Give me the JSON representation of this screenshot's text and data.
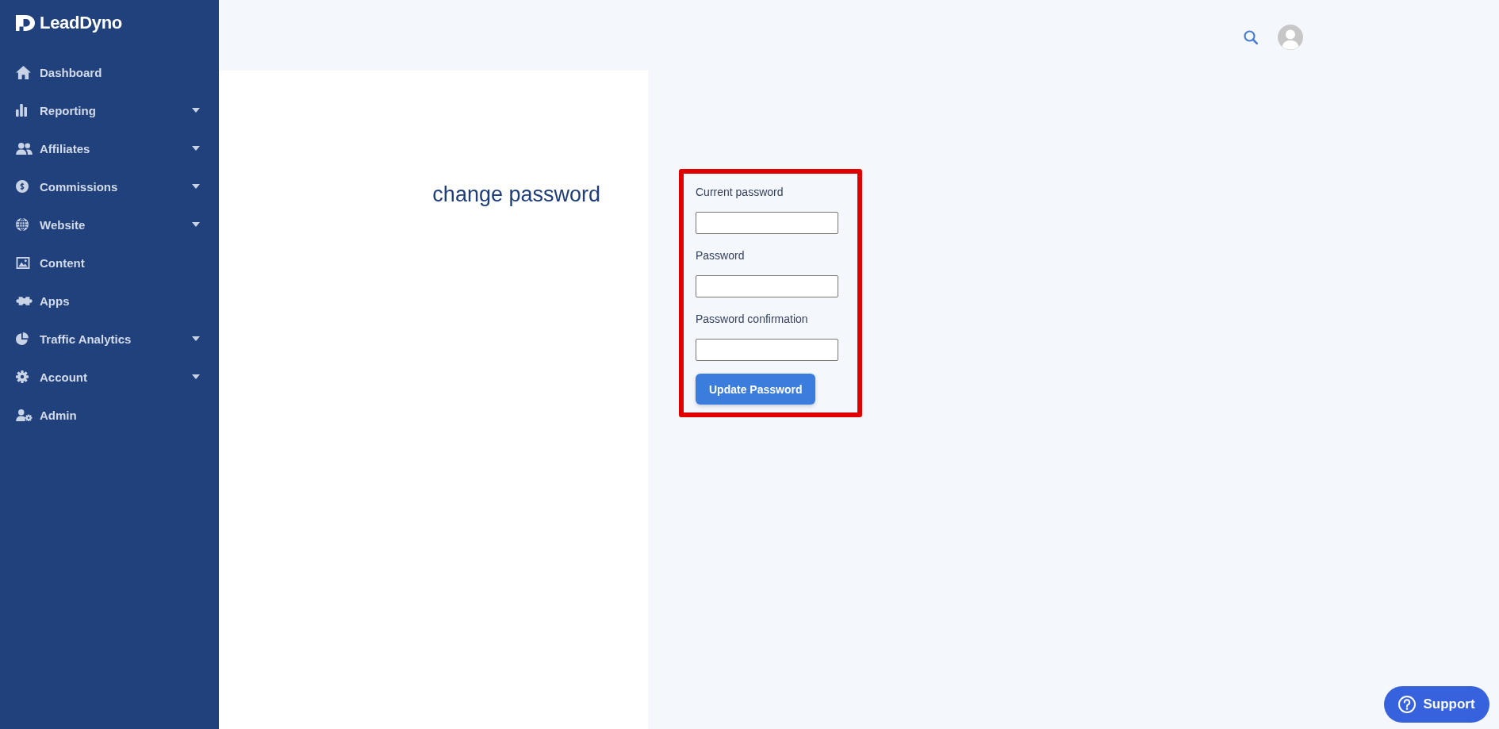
{
  "sidebar": {
    "logo": "LeadDyno",
    "items": [
      {
        "label": "Dashboard",
        "has_submenu": false,
        "selected": false
      },
      {
        "label": "Reporting",
        "has_submenu": true,
        "selected": false
      },
      {
        "label": "Affiliates",
        "has_submenu": true,
        "selected": false
      },
      {
        "label": "Commissions",
        "has_submenu": true,
        "selected": false
      },
      {
        "label": "Website",
        "has_submenu": true,
        "selected": false
      },
      {
        "label": "Content",
        "has_submenu": false,
        "selected": false
      },
      {
        "label": "Apps",
        "has_submenu": false,
        "selected": false
      },
      {
        "label": "Traffic Analytics",
        "has_submenu": true,
        "selected": false
      },
      {
        "label": "Account",
        "has_submenu": true,
        "selected": false
      },
      {
        "label": "Admin",
        "has_submenu": false,
        "selected": false
      }
    ]
  },
  "page": {
    "heading": "change password"
  },
  "form": {
    "highlighted": true,
    "fields": [
      {
        "label": "Current password"
      },
      {
        "label": "Password"
      },
      {
        "label": "Password confirmation"
      }
    ],
    "submit": "Update Password"
  },
  "support_button": {
    "label": "Support"
  }
}
